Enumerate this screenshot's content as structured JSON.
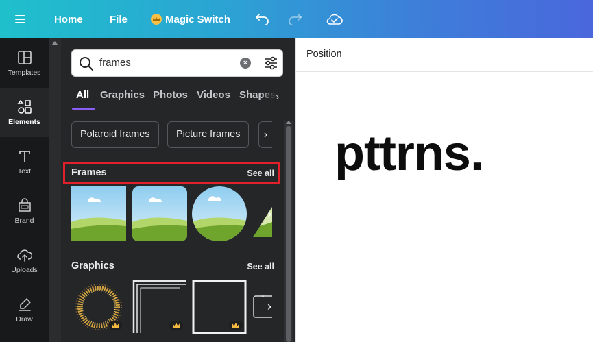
{
  "topbar": {
    "home": "Home",
    "file": "File",
    "magic_switch": "Magic Switch"
  },
  "rail": {
    "items": [
      {
        "label": "Templates",
        "icon": "templates-icon"
      },
      {
        "label": "Elements",
        "icon": "elements-icon",
        "active": true
      },
      {
        "label": "Text",
        "icon": "text-icon"
      },
      {
        "label": "Brand",
        "icon": "brand-icon"
      },
      {
        "label": "Uploads",
        "icon": "uploads-icon"
      },
      {
        "label": "Draw",
        "icon": "draw-icon"
      }
    ]
  },
  "search": {
    "value": "frames"
  },
  "tabs": [
    "All",
    "Graphics",
    "Photos",
    "Videos",
    "Shapes"
  ],
  "chips": [
    "Polaroid frames",
    "Picture frames"
  ],
  "sections": {
    "frames": {
      "title": "Frames",
      "see_all": "See all"
    },
    "graphics": {
      "title": "Graphics",
      "see_all": "See all"
    }
  },
  "canvas": {
    "position_label": "Position",
    "text": "pttrns."
  },
  "colors": {
    "accent": "#8b5cf6",
    "highlight": "#e0202b",
    "panel_bg": "#252627",
    "rail_bg": "#18191b"
  }
}
